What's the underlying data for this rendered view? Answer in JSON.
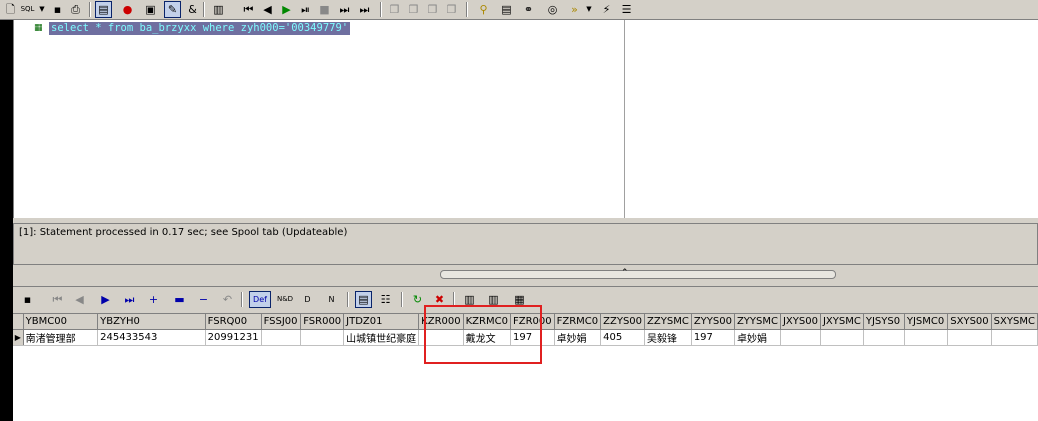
{
  "editor": {
    "sql": "select * from ba_brzyxx where zyh000='00349779'"
  },
  "status": {
    "message": "[1]: Statement processed in 0.17 sec; see Spool tab (Updateable)"
  },
  "toolbar2": {
    "def_label": "Def",
    "nd_label": "N&D",
    "d_label": "D",
    "n_label": "N"
  },
  "grid": {
    "columns": [
      "YBMC00",
      "YBZYH0",
      "FSRQ00",
      "FSSJ00",
      "FSR000",
      "JTDZ01",
      "KZR000",
      "KZRMC0",
      "FZR000",
      "FZRMC0",
      "ZZYS00",
      "ZZYSMC",
      "ZYYS00",
      "ZYYSMC",
      "JXYS00",
      "JXYSMC",
      "YJSYS0",
      "YJSMC0",
      "SXYS00",
      "SXYSMC"
    ],
    "rows": [
      [
        "南渚管理部",
        "245433543",
        "20991231",
        "",
        "",
        "山城镇世纪豪庭",
        "",
        "戴龙文",
        "197",
        "卓妙娟",
        "405",
        "吴毅锋",
        "197",
        "卓妙娟",
        "",
        "",
        "",
        "",
        "",
        ""
      ]
    ]
  },
  "colors": {
    "sql_highlight_bg": "#6f6fa0",
    "sql_text": "#7ffcff",
    "annotation_box": "#e02020"
  }
}
